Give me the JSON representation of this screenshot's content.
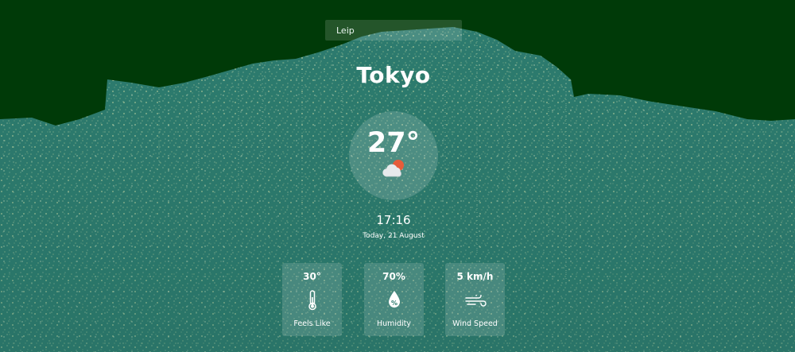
{
  "search": {
    "value": "Leip",
    "icon": "search-input"
  },
  "weather": {
    "city": "Tokyo",
    "temperature": "27°",
    "condition_icon": "partly-cloudy-icon",
    "time": "17:16",
    "date": "Today, 21 August"
  },
  "details": [
    {
      "value": "30°",
      "label": "Feels Like",
      "icon": "thermometer-icon"
    },
    {
      "value": "70%",
      "label": "Humidity",
      "icon": "humidity-drop-icon"
    },
    {
      "value": "5 km/h",
      "label": "Wind Speed",
      "icon": "wind-icon"
    }
  ],
  "colors": {
    "sky": "#003a08",
    "land": "#2e7f72",
    "sparkle": "#d9e8b0",
    "sun": "#e65c3a"
  }
}
